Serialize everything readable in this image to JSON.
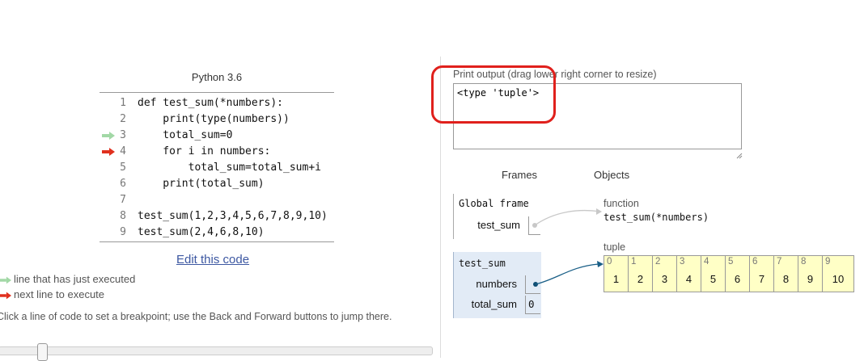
{
  "code_panel": {
    "language": "Python 3.6",
    "lines": [
      {
        "num": "1",
        "text": "def test_sum(*numbers):"
      },
      {
        "num": "2",
        "text": "    print(type(numbers))"
      },
      {
        "num": "3",
        "text": "    total_sum=0"
      },
      {
        "num": "4",
        "text": "    for i in numbers:"
      },
      {
        "num": "5",
        "text": "        total_sum=total_sum+i"
      },
      {
        "num": "6",
        "text": "    print(total_sum)"
      },
      {
        "num": "7",
        "text": ""
      },
      {
        "num": "8",
        "text": "test_sum(1,2,3,4,5,6,7,8,9,10)"
      },
      {
        "num": "9",
        "text": "test_sum(2,4,6,8,10)"
      }
    ],
    "just_executed_line": 3,
    "next_line": 4,
    "edit_link": "Edit this code",
    "legend_executed": "line that has just executed",
    "legend_next": "next line to execute",
    "help_text": "Click a line of code to set a breakpoint; use the Back and Forward buttons to jump there.",
    "colors": {
      "executed_arrow": "#a2d8a6",
      "next_arrow": "#e0301e"
    }
  },
  "output": {
    "label": "Print output (drag lower right corner to resize)",
    "text": "<type 'tuple'>",
    "highlight_color": "#e0201c"
  },
  "visualization": {
    "frames_header": "Frames",
    "objects_header": "Objects",
    "global_frame": {
      "name": "Global frame",
      "vars": [
        {
          "name": "test_sum",
          "pointer": "function"
        }
      ]
    },
    "call_frame": {
      "name": "test_sum",
      "vars": [
        {
          "name": "numbers",
          "pointer": "tuple"
        },
        {
          "name": "total_sum",
          "value": "0"
        }
      ]
    },
    "function_object": {
      "type": "function",
      "signature": "test_sum(*numbers)"
    },
    "tuple_object": {
      "type": "tuple",
      "items": [
        {
          "index": "0",
          "value": "1"
        },
        {
          "index": "1",
          "value": "2"
        },
        {
          "index": "2",
          "value": "3"
        },
        {
          "index": "3",
          "value": "4"
        },
        {
          "index": "4",
          "value": "5"
        },
        {
          "index": "5",
          "value": "6"
        },
        {
          "index": "6",
          "value": "7"
        },
        {
          "index": "7",
          "value": "8"
        },
        {
          "index": "8",
          "value": "9"
        },
        {
          "index": "9",
          "value": "10"
        }
      ]
    }
  }
}
